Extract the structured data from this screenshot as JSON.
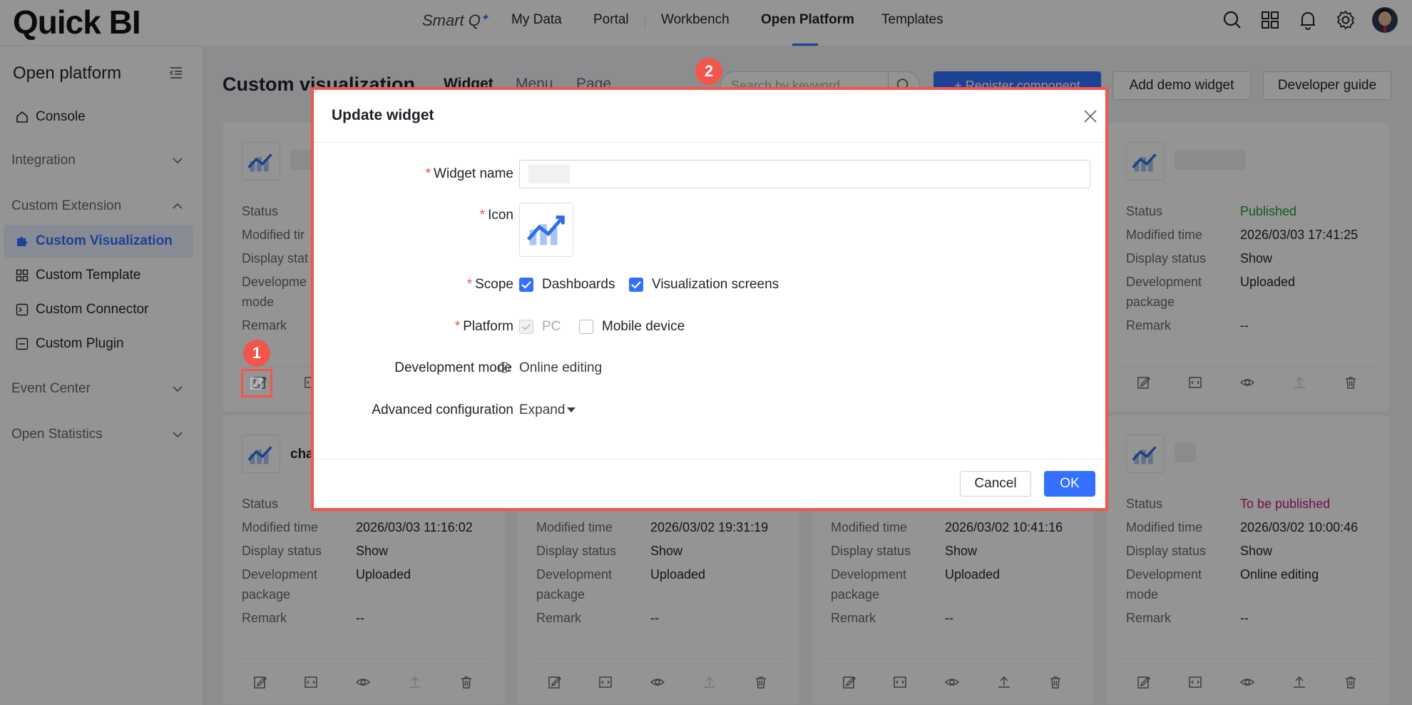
{
  "brand": {
    "logo": "Quick BI",
    "smartq": "Smart Q",
    "accent": "#3370ff",
    "highlight": "#f2564b"
  },
  "nav": {
    "items": [
      "My Data",
      "Portal",
      "Workbench",
      "Open Platform",
      "Templates"
    ],
    "active": "Open Platform"
  },
  "sidebar": {
    "title": "Open platform",
    "console": "Console",
    "integration": "Integration",
    "custom_extension": "Custom Extension",
    "items": [
      "Custom Visualization",
      "Custom Template",
      "Custom Connector",
      "Custom Plugin"
    ],
    "event_center": "Event Center",
    "open_statistics": "Open Statistics"
  },
  "main": {
    "title": "Custom visualization",
    "tabs": [
      "Widget",
      "Menu",
      "Page"
    ],
    "search_placeholder": "Search by keyword",
    "register_button": "+ Register component",
    "add_demo_button": "Add demo widget",
    "developer_guide_button": "Developer guide"
  },
  "labels": {
    "status": "Status",
    "modified": "Modified time",
    "modified_trunc": "Modified tir",
    "display": "Display status",
    "display_trunc": "Display stat",
    "dev": "Development",
    "dev_trunc": "Developme",
    "mode": "mode",
    "package": "package",
    "remark": "Remark"
  },
  "cards": {
    "top_right": {
      "status": "Published",
      "modified": "2026/03/03 17:41:25",
      "display": "Show",
      "dev": "Uploaded",
      "remark": "--"
    },
    "bottom": [
      {
        "name": "cha",
        "modified": "2026/03/03 11:16:02",
        "display": "Show",
        "dev": "Uploaded",
        "remark": "--"
      },
      {
        "modified": "2026/03/02 19:31:19",
        "display": "Show",
        "dev": "Uploaded",
        "remark": "--"
      },
      {
        "modified": "2026/03/02 10:41:16",
        "display": "Show",
        "dev": "Uploaded",
        "remark": "--"
      },
      {
        "status": "To be published",
        "modified": "2026/03/02 10:00:46",
        "display": "Show",
        "dev": "Online editing",
        "remark": "--"
      }
    ]
  },
  "badges": {
    "one": "1",
    "two": "2"
  },
  "modal": {
    "title": "Update widget",
    "widget_name_label": "Widget name",
    "icon_label": "Icon",
    "scope_label": "Scope",
    "scope_dashboards": "Dashboards",
    "scope_screens": "Visualization screens",
    "platform_label": "Platform",
    "platform_pc": "PC",
    "platform_mobile": "Mobile device",
    "devmode_label": "Development mode",
    "devmode_value": "Online editing",
    "advanced_label": "Advanced configuration",
    "advanced_value": "Expand",
    "cancel": "Cancel",
    "ok": "OK"
  }
}
